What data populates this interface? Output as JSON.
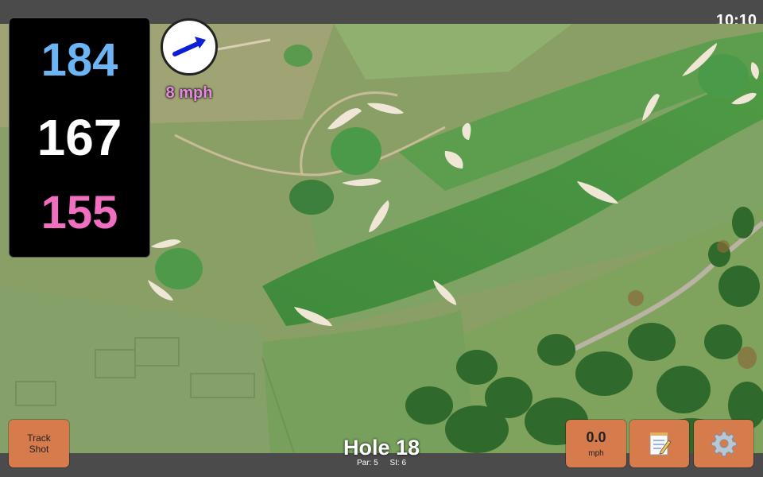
{
  "status_bar": {
    "time": "10:10"
  },
  "distances": {
    "back": "184",
    "middle": "167",
    "front": "155"
  },
  "wind": {
    "speed_label": "8 mph",
    "icon": "wind-direction-arrow-icon"
  },
  "hole": {
    "title": "Hole 18",
    "par": "Par: 5",
    "stroke_index": "SI: 6"
  },
  "buttons": {
    "track_shot": {
      "line1": "Track",
      "line2": "Shot"
    },
    "speed": {
      "value": "0.0",
      "unit": "mph"
    },
    "notes": {
      "icon": "notepad-icon"
    },
    "settings": {
      "icon": "gear-icon"
    }
  },
  "colors": {
    "back_distance": "#6bb5f5",
    "middle_distance": "#ffffff",
    "front_distance": "#f06fc0",
    "wind_label": "#e58ce0",
    "button": "#d67b4c"
  }
}
